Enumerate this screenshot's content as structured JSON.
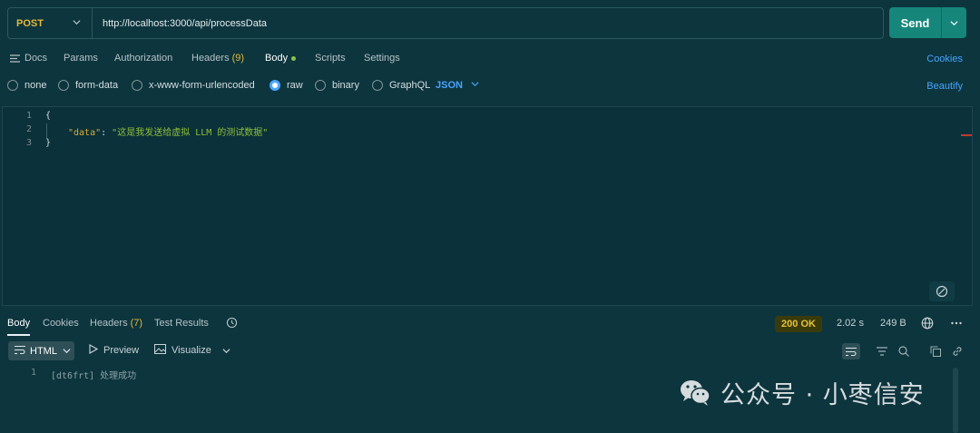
{
  "request": {
    "method": "POST",
    "url": "http://localhost:3000/api/processData",
    "send_label": "Send"
  },
  "tabs": {
    "docs": "Docs",
    "params": "Params",
    "authorization": "Authorization",
    "headers": "Headers",
    "headers_count": "(9)",
    "body": "Body",
    "scripts": "Scripts",
    "settings": "Settings",
    "cookies": "Cookies"
  },
  "body_types": {
    "none": "none",
    "form_data": "form-data",
    "urlencoded": "x-www-form-urlencoded",
    "raw": "raw",
    "binary": "binary",
    "graphql": "GraphQL",
    "selected": "raw",
    "language": "JSON",
    "beautify": "Beautify"
  },
  "editor": {
    "line_numbers": [
      "1",
      "2",
      "3"
    ],
    "line1": "{",
    "key": "\"data\"",
    "colon": ": ",
    "value": "\"这是我发送给虚拟 LLM 的测试数据\"",
    "line3": "}"
  },
  "response": {
    "tabs": {
      "body": "Body",
      "cookies": "Cookies",
      "headers": "Headers",
      "headers_count": "(7)",
      "test_results": "Test Results"
    },
    "status": "200 OK",
    "time": "2.02 s",
    "size": "249 B",
    "format": "HTML",
    "preview": "Preview",
    "visualize": "Visualize",
    "line_number": "1",
    "content": "[dt6frt] 处理成功"
  },
  "watermark": {
    "text": "公众号 · 小枣信安"
  },
  "colors": {
    "background": "#0d353e",
    "accent": "#47a4ff",
    "send": "#16867a",
    "method": "#e6b83a",
    "json_key": "#d8b03a",
    "json_string": "#8fbf3a"
  }
}
